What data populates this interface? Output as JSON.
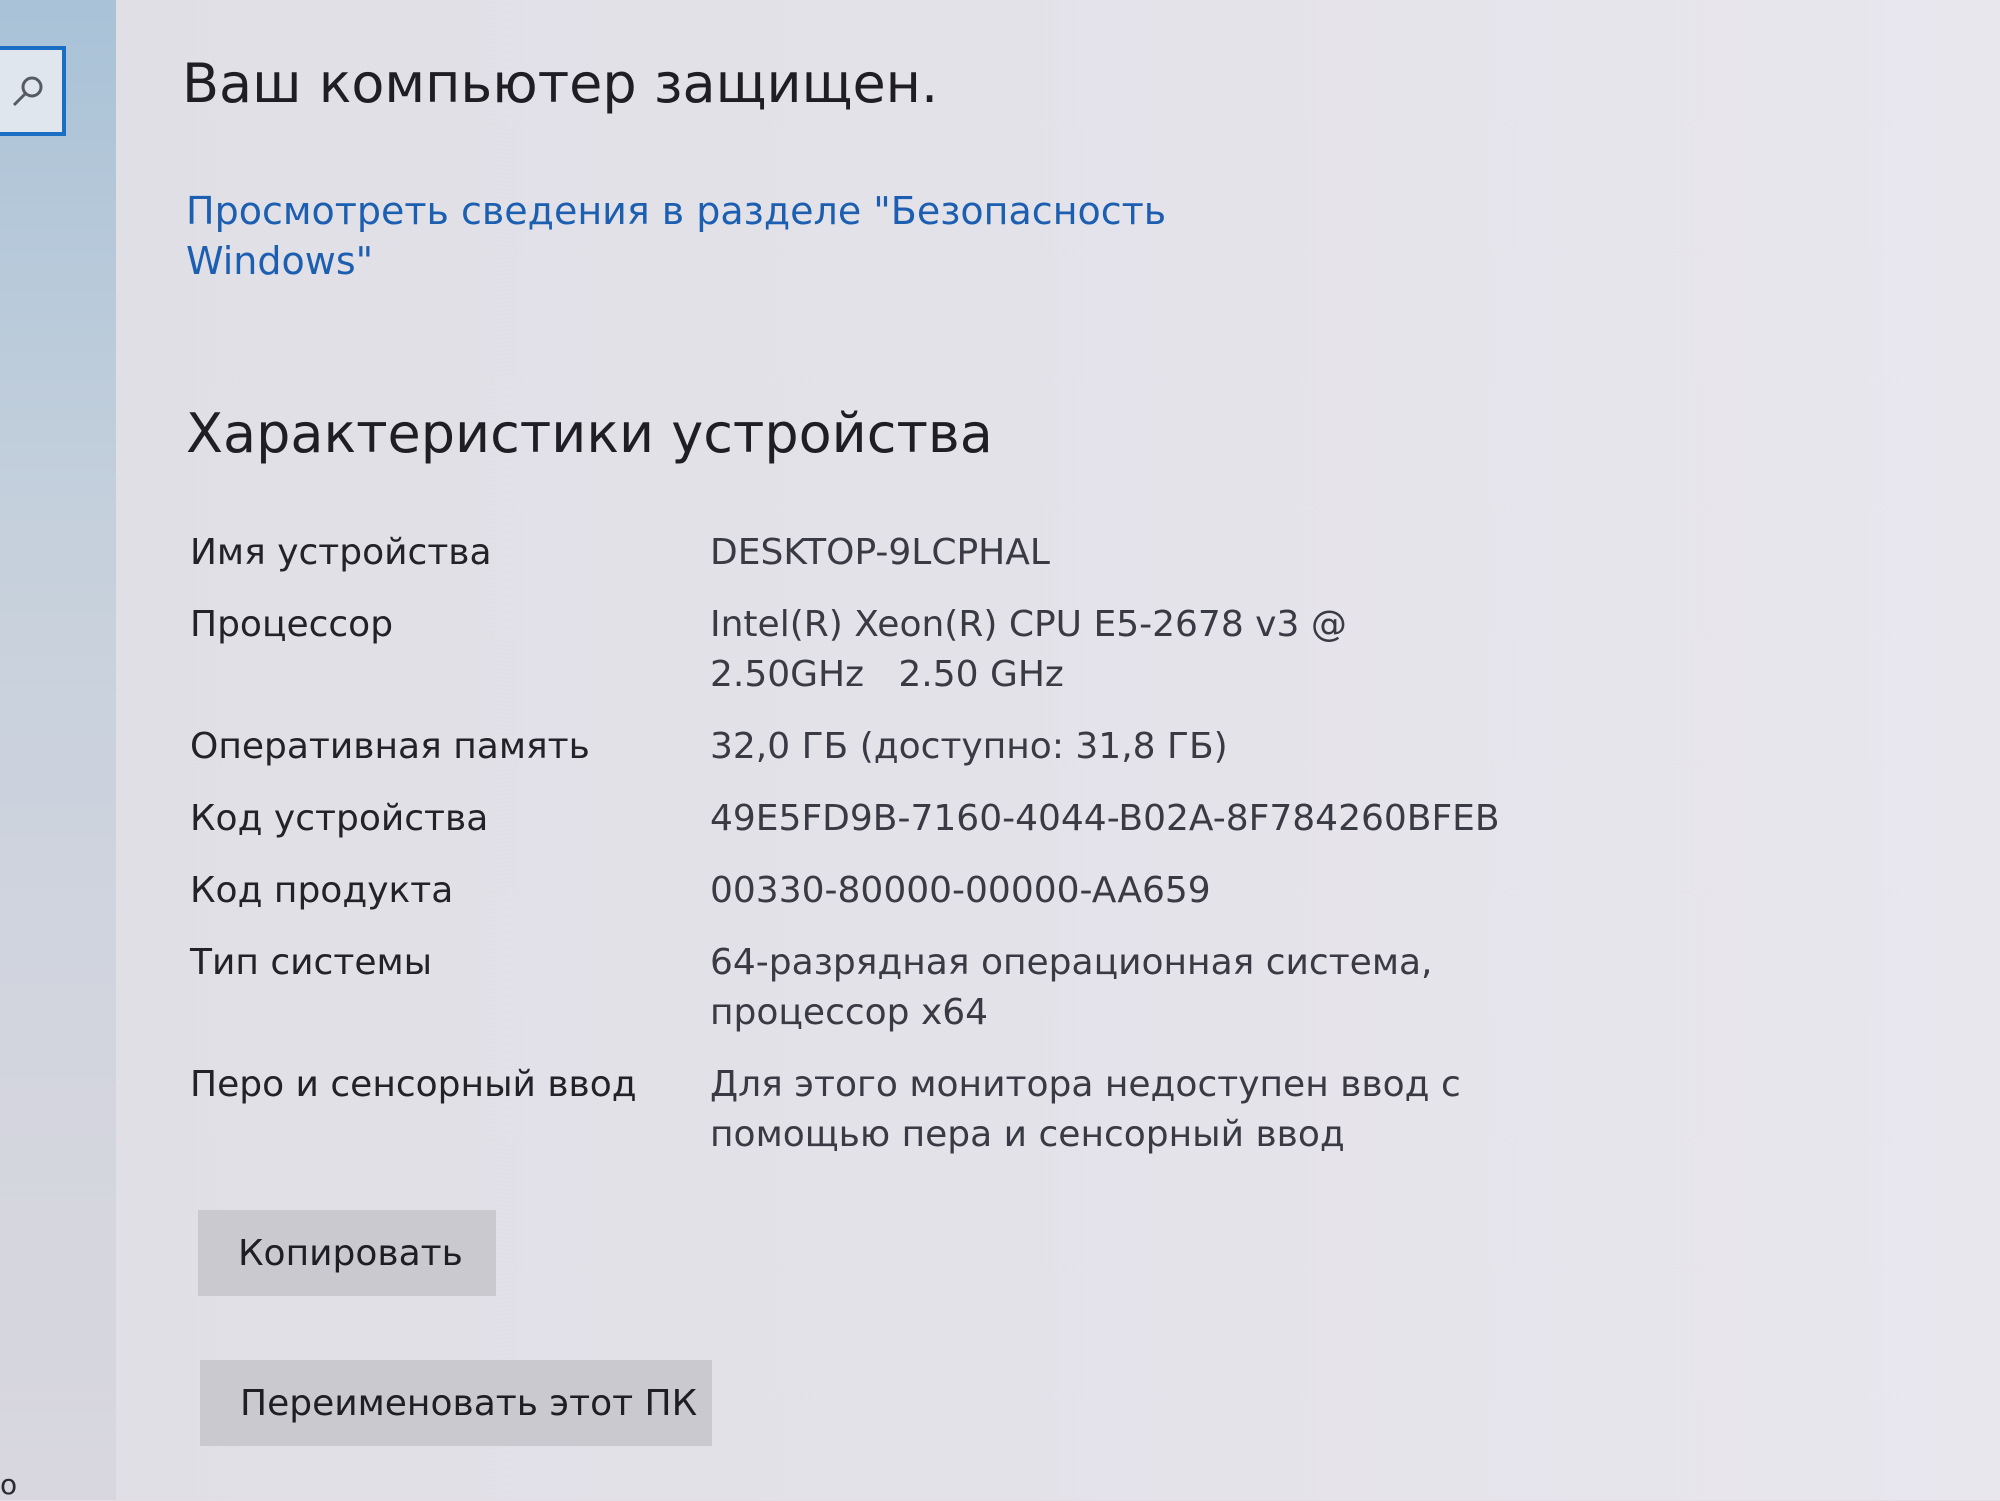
{
  "sidebar": {
    "search_icon": "search-icon",
    "edge_glyph": "o"
  },
  "security": {
    "title": "Ваш компьютер защищен.",
    "link_line1": "Просмотреть сведения в разделе \"Безопасность",
    "link_line2": "Windows\""
  },
  "specs": {
    "title": "Характеристики устройства",
    "rows": [
      {
        "label": "Имя устройства",
        "value_line1": "DESKTOP-9LCPHAL",
        "value_line2": ""
      },
      {
        "label": "Процессор",
        "value_line1": "Intel(R) Xeon(R) CPU E5-2678 v3 @",
        "value_line2": "2.50GHz   2.50 GHz"
      },
      {
        "label": "Оперативная память",
        "value_line1": "32,0 ГБ (доступно: 31,8 ГБ)",
        "value_line2": ""
      },
      {
        "label": "Код устройства",
        "value_line1": "49E5FD9B-7160-4044-B02A-8F784260BFEB",
        "value_line2": ""
      },
      {
        "label": "Код продукта",
        "value_line1": "00330-80000-00000-AA659",
        "value_line2": ""
      },
      {
        "label": "Тип системы",
        "value_line1": "64-разрядная операционная система,",
        "value_line2": "процессор x64"
      },
      {
        "label": "Перо и сенсорный ввод",
        "value_line1": "Для этого монитора недоступен ввод с",
        "value_line2": "помощью пера и сенсорный ввод"
      }
    ]
  },
  "buttons": {
    "copy": "Копировать",
    "rename": "Переименовать этот ПК"
  },
  "colors": {
    "link": "#1c5fb0",
    "accent_border": "#1a6fc4",
    "button_bg": "#cbc9d0",
    "background": "#e2e0e6"
  }
}
